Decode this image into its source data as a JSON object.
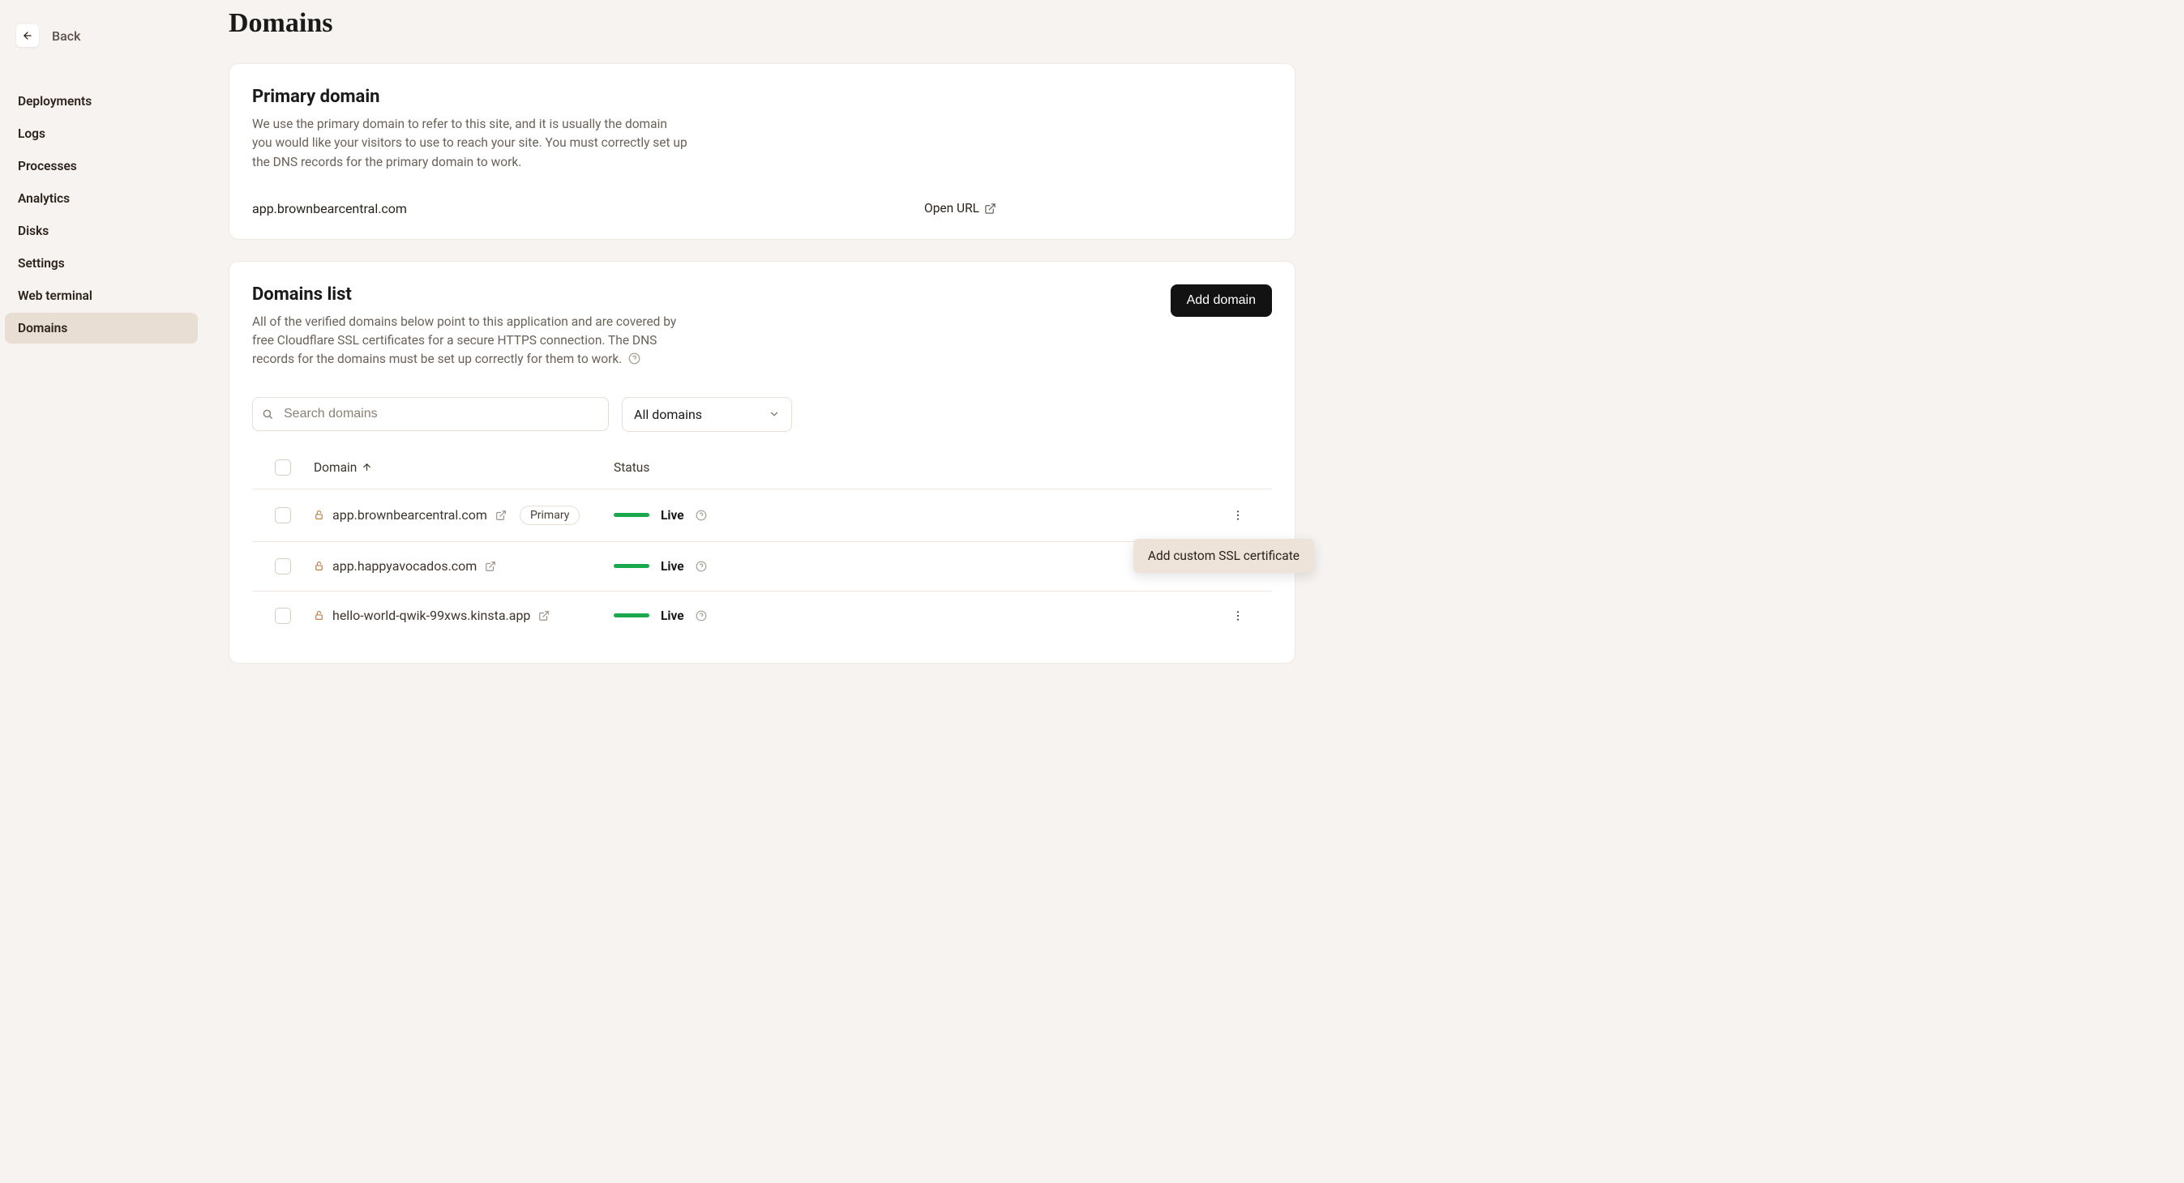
{
  "nav": {
    "back_label": "Back",
    "items": [
      "Deployments",
      "Logs",
      "Processes",
      "Analytics",
      "Disks",
      "Settings",
      "Web terminal",
      "Domains"
    ],
    "active_index": 7
  },
  "page": {
    "title": "Domains"
  },
  "primary_card": {
    "title": "Primary domain",
    "subtitle": "We use the primary domain to refer to this site, and it is usually the domain you would like your visitors to use to reach your site. You must correctly set up the DNS records for the primary domain to work.",
    "domain": "app.brownbearcentral.com",
    "open_label": "Open URL"
  },
  "list_card": {
    "title": "Domains list",
    "subtitle": "All of the verified domains below point to this application and are covered by free Cloudflare SSL certificates for a secure HTTPS connection. The DNS records for the domains must be set up correctly for them to work.",
    "add_label": "Add domain",
    "search_placeholder": "Search domains",
    "filter_selected": "All domains",
    "col_domain": "Domain",
    "col_status": "Status",
    "rows": [
      {
        "domain": "app.brownbearcentral.com",
        "primary": true,
        "primary_label": "Primary",
        "status": "Live",
        "has_more": true
      },
      {
        "domain": "app.happyavocados.com",
        "primary": false,
        "status": "Live",
        "has_more": false
      },
      {
        "domain": "hello-world-qwik-99xws.kinsta.app",
        "primary": false,
        "status": "Live",
        "has_more": true
      }
    ],
    "popover_label": "Add custom SSL certificate"
  }
}
